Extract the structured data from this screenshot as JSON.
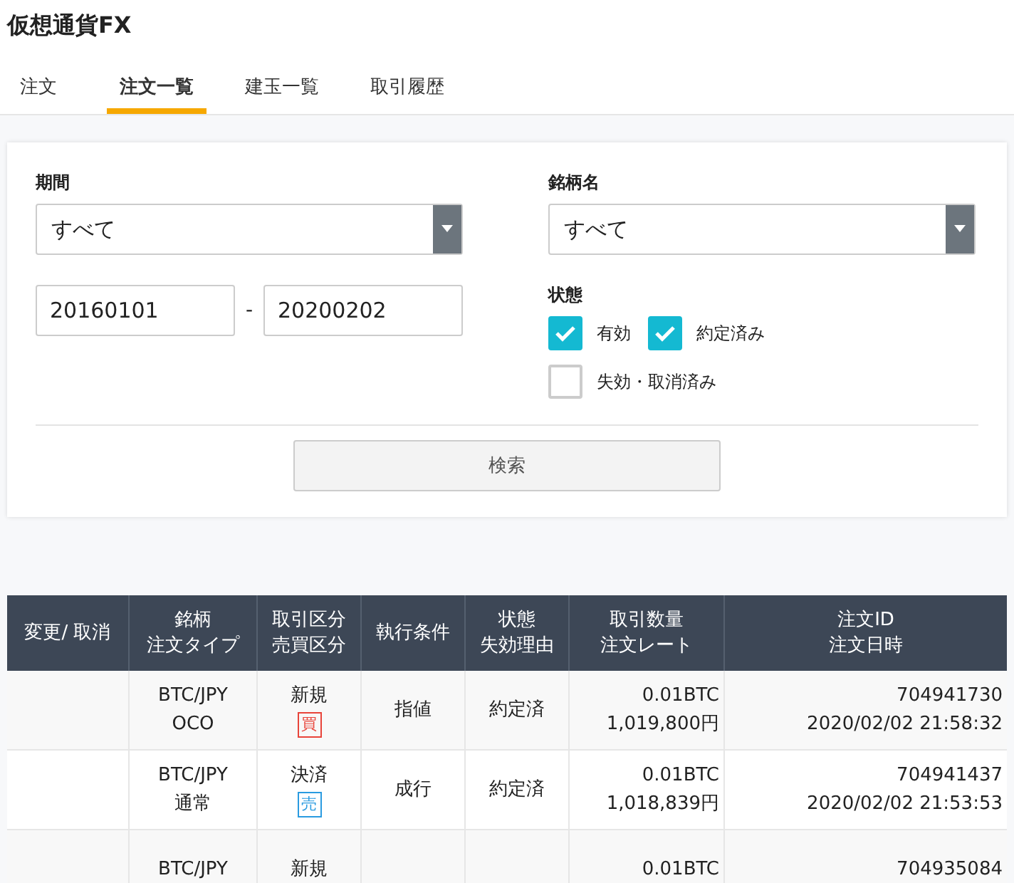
{
  "app_title": "仮想通貨FX",
  "tabs": [
    {
      "label": "注文",
      "selected": false
    },
    {
      "label": "注文一覧",
      "selected": true
    },
    {
      "label": "建玉一覧",
      "selected": false
    },
    {
      "label": "取引履歴",
      "selected": false
    }
  ],
  "filter": {
    "period": {
      "label": "期間",
      "value": "すべて"
    },
    "date_from": "20160101",
    "date_separator": "-",
    "date_to": "20200202",
    "symbol": {
      "label": "銘柄名",
      "value": "すべて"
    },
    "status": {
      "label": "状態",
      "options": [
        {
          "label": "有効",
          "checked": true
        },
        {
          "label": "約定済み",
          "checked": true
        },
        {
          "label": "失効・取消済み",
          "checked": false
        }
      ]
    },
    "search_button": "検索"
  },
  "table": {
    "columns": [
      [
        "変更/ 取消"
      ],
      [
        "銘柄",
        "注文タイプ"
      ],
      [
        "取引区分",
        "売買区分"
      ],
      [
        "執行条件"
      ],
      [
        "状態",
        "失効理由"
      ],
      [
        "取引数量",
        "注文レート"
      ],
      [
        "注文ID",
        "注文日時"
      ]
    ],
    "rows": [
      {
        "symbol": "BTC/JPY",
        "order_type": "OCO",
        "trade_type": "新規",
        "side": {
          "label": "買",
          "kind": "buy"
        },
        "condition": "指値",
        "status": "約定済",
        "quantity": "0.01BTC",
        "rate": "1,019,800円",
        "order_id": "704941730",
        "datetime": "2020/02/02 21:58:32"
      },
      {
        "symbol": "BTC/JPY",
        "order_type": "通常",
        "trade_type": "決済",
        "side": {
          "label": "売",
          "kind": "sell"
        },
        "condition": "成行",
        "status": "約定済",
        "quantity": "0.01BTC",
        "rate": "1,018,839円",
        "order_id": "704941437",
        "datetime": "2020/02/02 21:53:53"
      },
      {
        "symbol": "BTC/JPY",
        "trade_type": "新規",
        "quantity": "0.01BTC",
        "order_id": "704935084"
      }
    ]
  }
}
